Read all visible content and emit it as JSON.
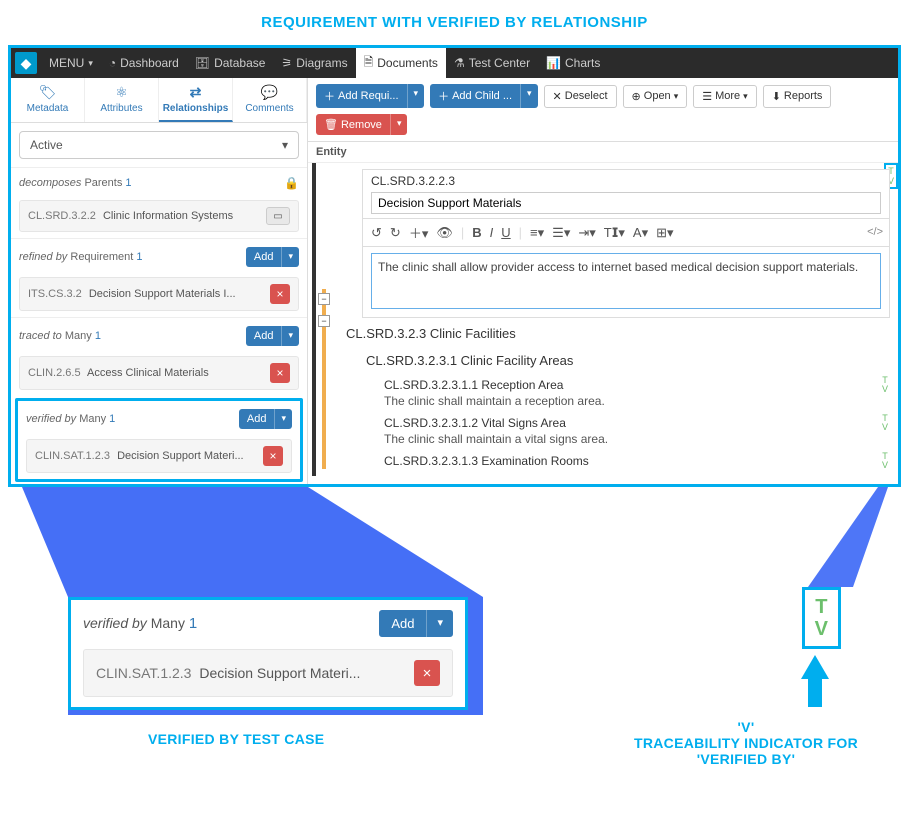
{
  "annotations": {
    "main_title": "REQUIREMENT WITH VERIFIED BY RELATIONSHIP",
    "verified_label": "VERIFIED BY TEST CASE",
    "trace_label_1": "'V'",
    "trace_label_2": "TRACEABILITY INDICATOR FOR",
    "trace_label_3": "'VERIFIED BY'"
  },
  "menubar": {
    "menu": "MENU",
    "items": [
      "Dashboard",
      "Database",
      "Diagrams",
      "Documents",
      "Test Center",
      "Charts"
    ],
    "active": "Documents"
  },
  "side_tabs": {
    "items": [
      "Metadata",
      "Attributes",
      "Relationships",
      "Comments"
    ],
    "active": "Relationships"
  },
  "active_filter": "Active",
  "relationships": {
    "decomposes": {
      "label": "decomposes",
      "suffix": "Parents",
      "count": "1",
      "item_id": "CL.SRD.3.2.2",
      "item_name": "Clinic Information Systems"
    },
    "refined": {
      "label": "refined by",
      "suffix": "Requirement",
      "count": "1",
      "add": "Add",
      "item_id": "ITS.CS.3.2",
      "item_name": "Decision Support Materials I..."
    },
    "traced": {
      "label": "traced to",
      "suffix": "Many",
      "count": "1",
      "add": "Add",
      "item_id": "CLIN.2.6.5",
      "item_name": "Access Clinical Materials"
    },
    "verified": {
      "label": "verified by",
      "suffix": "Many",
      "count": "1",
      "add": "Add",
      "item_id": "CLIN.SAT.1.2.3",
      "item_name": "Decision Support Materi..."
    }
  },
  "toolbar": {
    "add_req": "Add Requi...",
    "add_child": "Add Child ...",
    "deselect": "Deselect",
    "open": "Open",
    "more": "More",
    "reports": "Reports",
    "remove": "Remove"
  },
  "entity_label": "Entity",
  "requirement": {
    "id": "CL.SRD.3.2.2.3",
    "title": "Decision Support Materials",
    "text": "The clinic shall allow provider access to internet based medical decision support materials."
  },
  "sections": {
    "s1": "CL.SRD.3.2.3 Clinic Facilities",
    "s2": "CL.SRD.3.2.3.1 Clinic Facility Areas",
    "r1_id": "CL.SRD.3.2.3.1.1 Reception Area",
    "r1_txt": "The clinic shall maintain a reception area.",
    "r2_id": "CL.SRD.3.2.3.1.2 Vital Signs Area",
    "r2_txt": "The clinic shall maintain a vital signs area.",
    "r3_id": "CL.SRD.3.2.3.1.3 Examination Rooms"
  },
  "tv": {
    "t": "T",
    "v": "V"
  },
  "enlarged_verified": {
    "label": "verified by",
    "suffix": "Many",
    "count": "1",
    "add": "Add",
    "item_id": "CLIN.SAT.1.2.3",
    "item_name": "Decision Support Materi..."
  }
}
